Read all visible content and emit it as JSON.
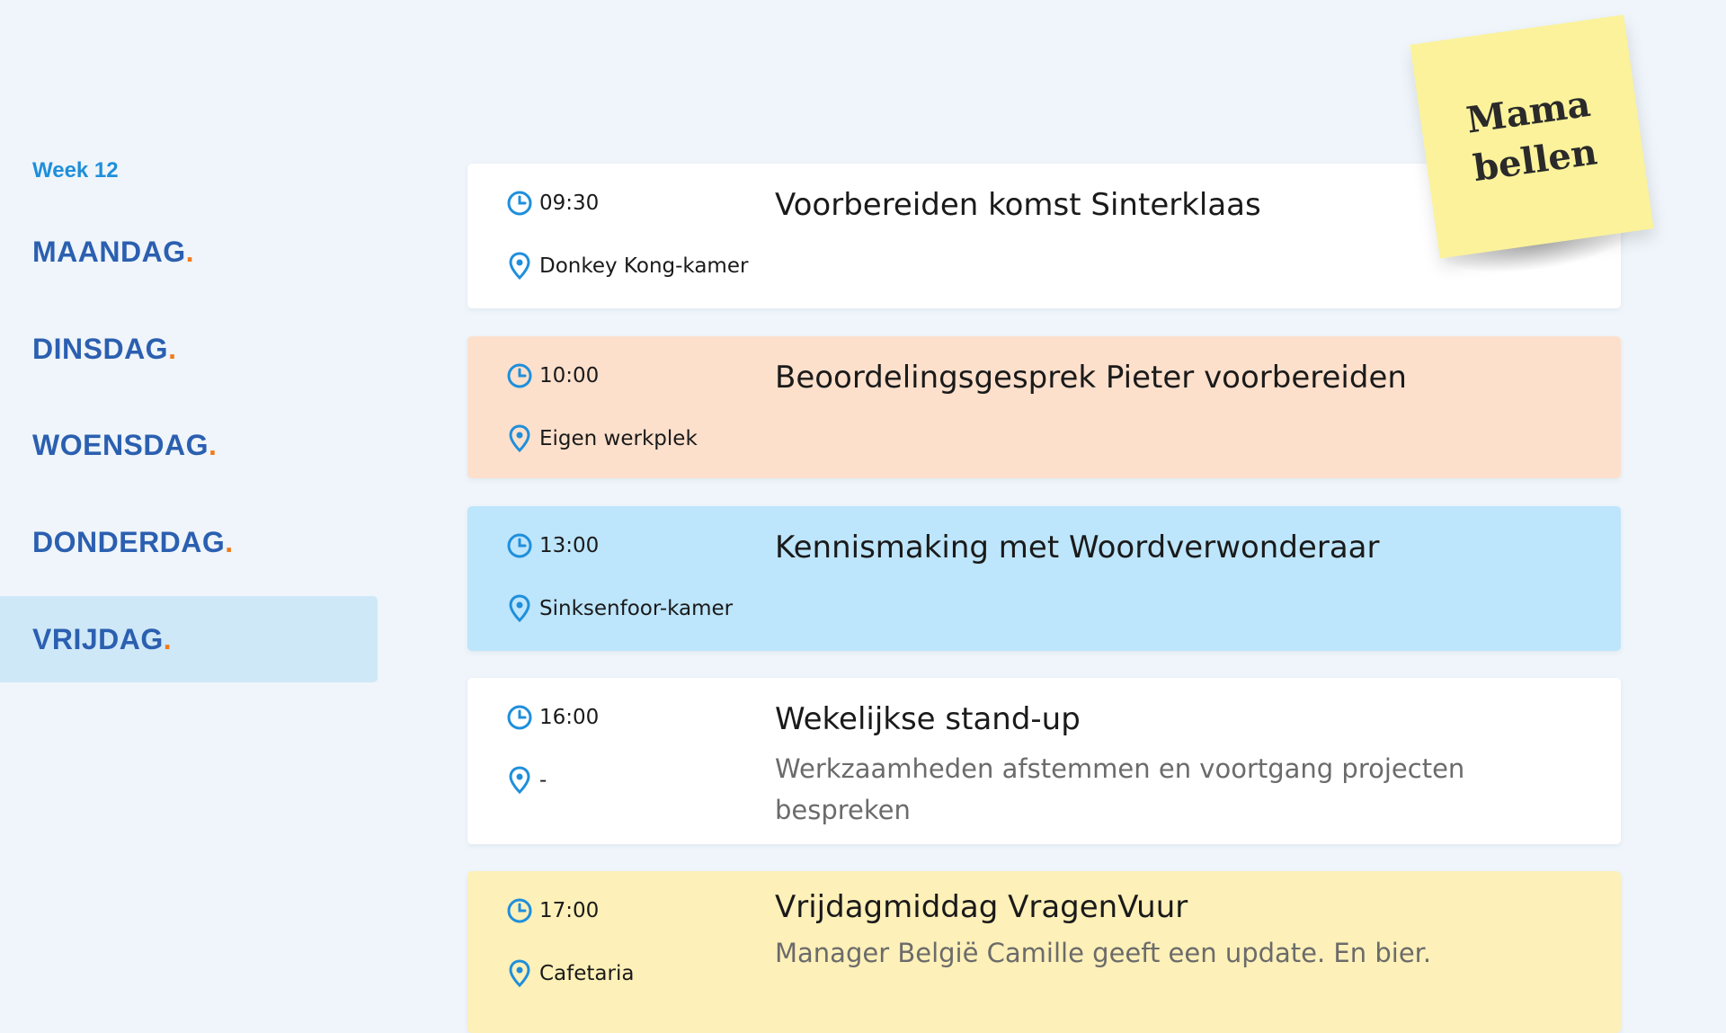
{
  "sidebar": {
    "week_label": "Week 12",
    "days": [
      {
        "label": "MAANDAG",
        "dot": "."
      },
      {
        "label": "DINSDAG",
        "dot": "."
      },
      {
        "label": "WOENSDAG",
        "dot": "."
      },
      {
        "label": "DONDERDAG",
        "dot": "."
      },
      {
        "label": "VRIJDAG",
        "dot": "."
      }
    ],
    "active_day": "VRIJDAG"
  },
  "agenda": [
    {
      "time": "09:30",
      "location": "Donkey Kong-kamer",
      "title": "Voorbereiden komst Sinterklaas",
      "description": "",
      "color": "#ffffff"
    },
    {
      "time": "10:00",
      "location": "Eigen werkplek",
      "title": "Beoordelingsgesprek Pieter voorbereiden",
      "description": "",
      "color": "#fde0cc"
    },
    {
      "time": "13:00",
      "location": "Sinksenfoor-kamer",
      "title": "Kennismaking met Woordverwonderaar",
      "description": "",
      "color": "#bde5fb"
    },
    {
      "time": "16:00",
      "location": "-",
      "title": "Wekelijkse stand-up",
      "description": "Werkzaamheden afstemmen en voortgang projecten bespreken",
      "color": "#ffffff"
    },
    {
      "time": "17:00",
      "location": "Cafetaria",
      "title": "Vrijdagmiddag VragenVuur",
      "description": "Manager België Camille geeft een update. En bier.",
      "color": "#fdf0b8"
    }
  ],
  "sticky_note": {
    "line1": "Mama",
    "line2": "bellen",
    "color": "#fbf29b"
  },
  "colors": {
    "accent_blue": "#2b5fb0",
    "icon_blue": "#1f8fdb",
    "dot_orange": "#f07a1a",
    "active_day_bg": "#cfe8f8",
    "page_bg": "#eff5fa"
  },
  "icons": {
    "time": "clock-icon",
    "location": "location-pin-icon"
  }
}
